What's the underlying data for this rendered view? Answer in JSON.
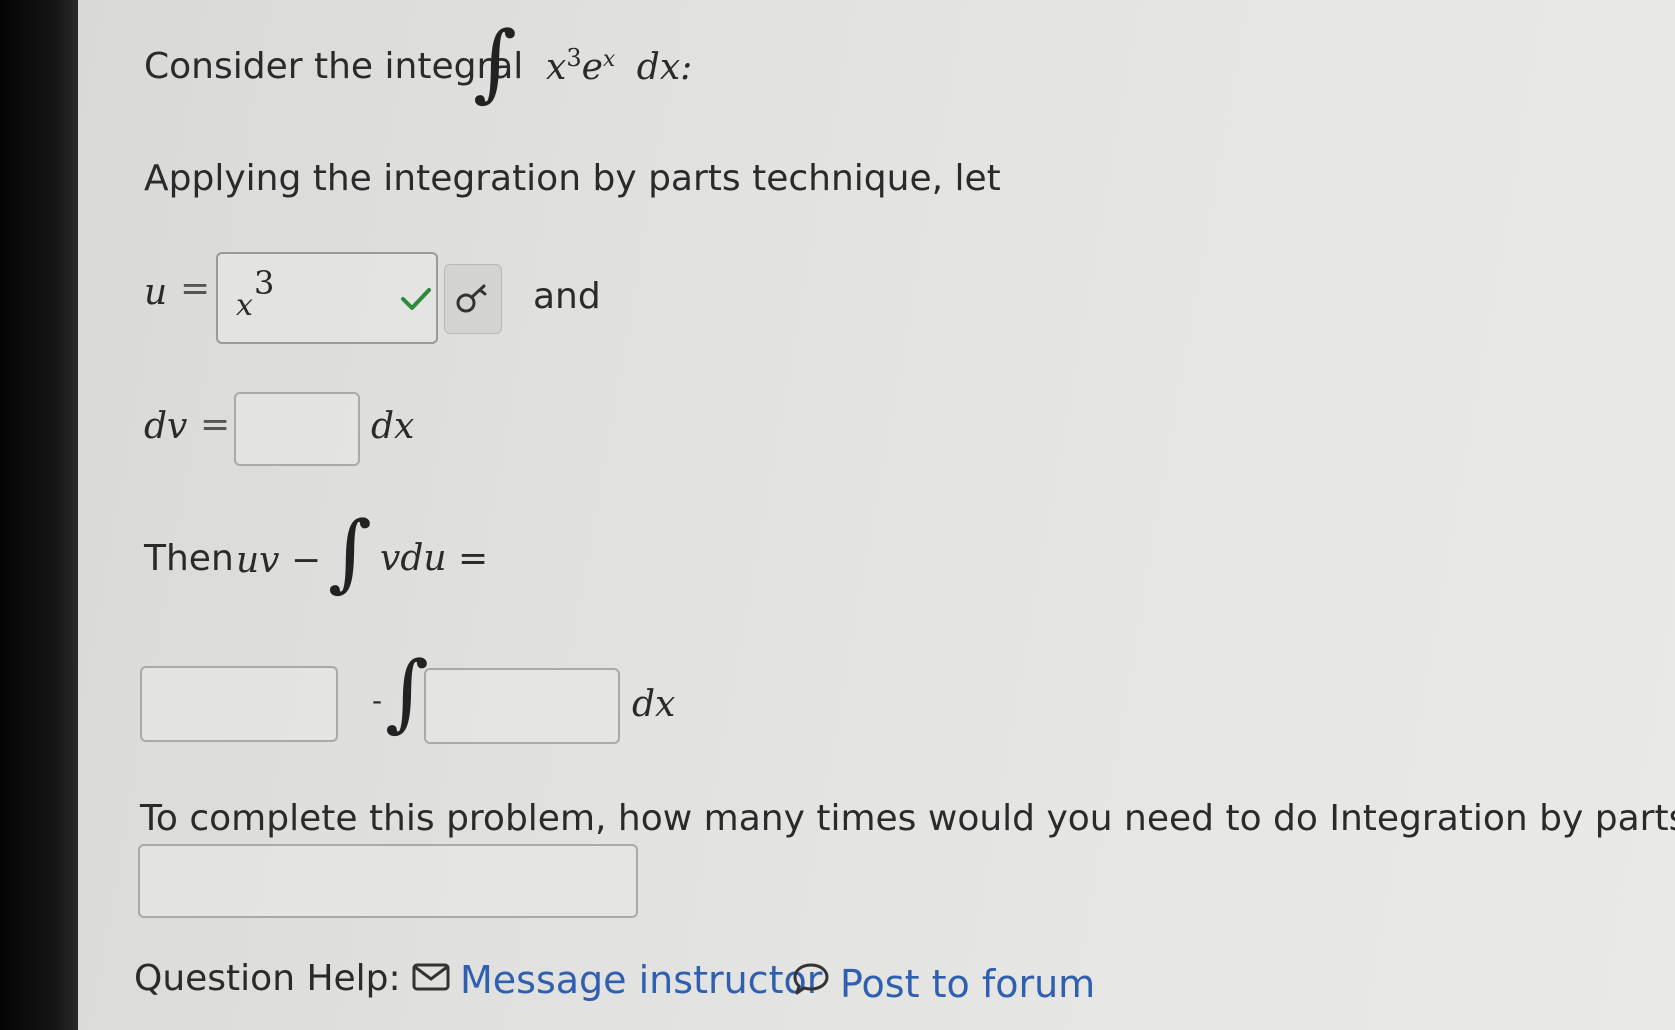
{
  "question": {
    "intro_label": "Consider the integral",
    "integral_expr": {
      "base": "x",
      "power": "3",
      "exp_base": "e",
      "exp_power": "x",
      "differential": "dx:"
    },
    "parts_label": "Applying the integration by parts technique, let",
    "u_label": "u",
    "equals": "=",
    "u_answer": {
      "base": "x",
      "power": "3"
    },
    "and_label": "and",
    "dv_label": "dv",
    "dv_suffix": "dx",
    "then_label": "Then",
    "uv_expr": "uv −",
    "vdu_expr": "vdu",
    "then_equals": "=",
    "minus": "-",
    "final_suffix": "dx",
    "count_label": "To complete this problem, how many times would you need to do Integration by parts?"
  },
  "help": {
    "label": "Question Help:",
    "message_link": "Message instructor",
    "forum_link": "Post to forum"
  },
  "colors": {
    "check": "#2e8b3a",
    "link": "#2f5fb0"
  },
  "icons": {
    "check": "check-icon",
    "key": "key-icon",
    "mail": "mail-icon",
    "forum": "speech-bubble-icon"
  }
}
